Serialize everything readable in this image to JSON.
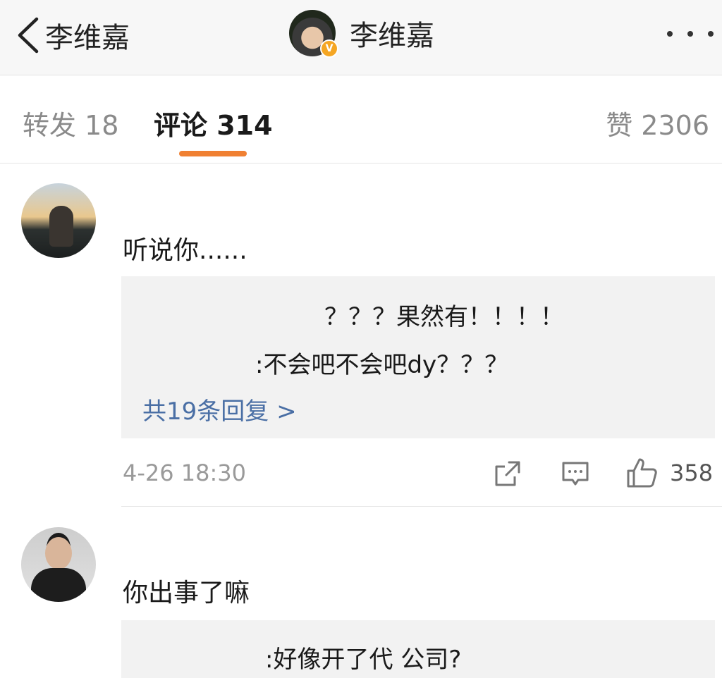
{
  "nav": {
    "back_label": "李维嘉",
    "title": "李维嘉",
    "verified_badge": "V"
  },
  "tabs": {
    "repost": "转发 18",
    "comment": "评论 314",
    "like": "赞 2306",
    "active_color": "#f08032"
  },
  "comments": [
    {
      "text": "听说你......",
      "replies": [
        "？？？果然有！！！！",
        ":不会吧不会吧dy？？？"
      ],
      "more_replies": "共19条回复 >",
      "time": "4-26 18:30",
      "likes": "358"
    },
    {
      "text": "你出事了嘛",
      "replies": [
        ":好像开了代  公司?"
      ]
    }
  ],
  "icons": [
    "back-chevron-icon",
    "more-dots-icon",
    "share-icon",
    "comment-icon",
    "thumbs-up-icon"
  ],
  "colors": {
    "link": "#4a6fa5",
    "reply_bg": "#f2f2f2",
    "badge": "#f5a623"
  }
}
